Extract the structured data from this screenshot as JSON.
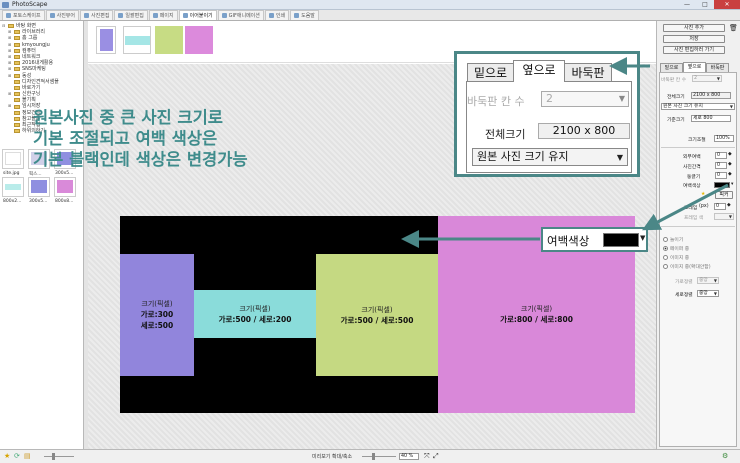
{
  "window": {
    "title": "PhotoScape",
    "controls": [
      "—",
      "□",
      "✕"
    ]
  },
  "tabs": [
    {
      "label": "포토스케이프"
    },
    {
      "label": "사진뷰어"
    },
    {
      "label": "사진편집"
    },
    {
      "label": "일괄편집"
    },
    {
      "label": "페이지"
    },
    {
      "label": "이어붙이기",
      "active": true
    },
    {
      "label": "GIF애니메이션"
    },
    {
      "label": "인쇄"
    },
    {
      "label": "도움말"
    }
  ],
  "tree": [
    {
      "label": "바탕 화면",
      "pm": "⊟"
    },
    {
      "label": "라이브러리",
      "pm": "⊞"
    },
    {
      "label": "홈 그룹",
      "pm": "⊞"
    },
    {
      "label": "kmyoungju",
      "pm": "⊞"
    },
    {
      "label": "컴퓨터",
      "pm": "⊞"
    },
    {
      "label": "네트워크",
      "pm": "⊞"
    },
    {
      "label": "2016내게활용",
      "pm": "⊞"
    },
    {
      "label": "SNS마케팅",
      "pm": "⊞"
    },
    {
      "label": "동성",
      "pm": "⊞"
    },
    {
      "label": "디자인견적서샘플",
      "pm": ""
    },
    {
      "label": "바로가기",
      "pm": ""
    },
    {
      "label": "신한구닝",
      "pm": "⊞"
    },
    {
      "label": "블기획",
      "pm": ""
    },
    {
      "label": "임시저장",
      "pm": "⊞"
    },
    {
      "label": "정보건닝",
      "pm": ""
    },
    {
      "label": "참고블룸",
      "pm": ""
    },
    {
      "label": "최근작업",
      "pm": ""
    },
    {
      "label": "하위의하기",
      "pm": ""
    }
  ],
  "thumbnails": [
    {
      "caption": "site.jpg",
      "color": "#ffffff"
    },
    {
      "caption": "픽스...",
      "color": "#d0d0e8"
    },
    {
      "caption": "300x5...",
      "color": "#8f8fe0"
    },
    {
      "caption": "800x2...",
      "color": "#b9ecea"
    },
    {
      "caption": "300x5...",
      "color": "#8f8fe0"
    },
    {
      "caption": "800x8...",
      "color": "#d98ad9"
    }
  ],
  "strip_colors": [
    "#9a8fe3",
    "#a5e6e6",
    "#c7dc84",
    "#dc8adc"
  ],
  "annotation": {
    "line1": "원본사진 중  큰 사진 크기로",
    "line2": "기본 조절되고 여백 색상은",
    "line3": "기본 블랙인데 색상은 변경가능"
  },
  "images": [
    {
      "l1": "크기(픽셀)",
      "l2a": "가로:300",
      "l2b": "세로:500",
      "color": "#9185dc"
    },
    {
      "l1": "크기(픽셀)",
      "l2a": "가로:500 / 세로:200",
      "color": "#8adcda"
    },
    {
      "l1": "크기(픽셀)",
      "l2a": "가로:500 / 세로:500",
      "color": "#c5d982"
    },
    {
      "l1": "크기(픽셀)",
      "l2a": "가로:800 / 세로:800",
      "color": "#d988d9"
    }
  ],
  "right": {
    "add_photo": "사진 추가",
    "save": "저장",
    "edit_photo": "사진 편집하러 가기",
    "tabs": [
      "밑으로",
      "옆으로",
      "바둑판"
    ],
    "grid_count_label": "바둑판 칸 수",
    "grid_count_value": "2",
    "total_size_label": "전체크기",
    "total_size_value": "2100 x 800",
    "keep_size": "원본 사진 크기 유지",
    "base_size_label": "기준크기",
    "base_size_value": "세로 800",
    "scale_label": "크기조절",
    "scale_value": "100%",
    "outer_margin_label": "외부여백",
    "outer_margin_value": "0",
    "photo_gap_label": "사진간격",
    "photo_gap_value": "0",
    "round_label": "둥글기",
    "round_value": "0",
    "margin_color_label": "여백색상",
    "pick_label": "픽커",
    "frame_label": "프레임",
    "frame_unit": "(px)",
    "frame_value": "0",
    "frame_color_label": "프레임 색",
    "radio_fill": "늘이기",
    "radio_center": "페이퍼 중",
    "radio_image": "이미지 중",
    "radio_image2": "이미지 중(확대안함)",
    "halign_label": "가로정렬",
    "halign_value": "중앙",
    "valign_label": "세로정렬",
    "valign_value": "중앙"
  },
  "zoom": {
    "tabs": [
      "밑으로",
      "옆으로",
      "바둑판"
    ],
    "grid_count_label": "바둑판 칸 수",
    "grid_count_value": "2",
    "total_size_label": "전체크기",
    "total_size_value": "2100 x 800",
    "keep_size": "원본 사진 크기 유지"
  },
  "margin_callout": {
    "label": "여백색상",
    "color": "#000000"
  },
  "status": {
    "preview_label": "미리보기 확대/축소",
    "zoom": "40 %"
  },
  "accent": "#4b8787"
}
